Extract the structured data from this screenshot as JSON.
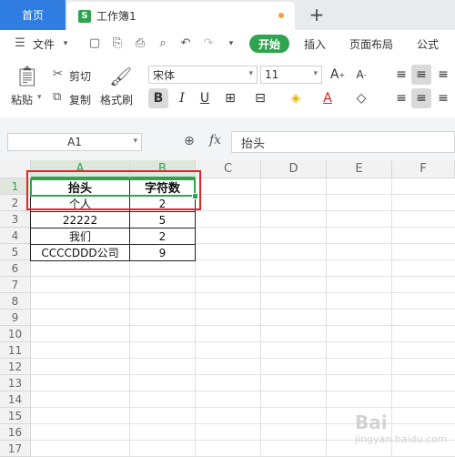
{
  "tabs": {
    "home": "首页",
    "workbook": "工作簿1",
    "add": "+"
  },
  "menu": {
    "file": "文件",
    "start": "开始",
    "insert": "插入",
    "page_layout": "页面布局",
    "formula": "公式"
  },
  "ribbon": {
    "paste": "粘贴",
    "cut": "剪切",
    "copy": "复制",
    "format_painter": "格式刷",
    "font_name": "宋体",
    "font_size": "11"
  },
  "formula_bar": {
    "name_box": "A1",
    "fx": "fx",
    "content": "抬头"
  },
  "grid": {
    "columns": [
      "A",
      "B",
      "C",
      "D",
      "E",
      "F"
    ],
    "rows": [
      "1",
      "2",
      "3",
      "4",
      "5",
      "6",
      "7",
      "8",
      "9",
      "10",
      "11",
      "12",
      "13",
      "14",
      "15",
      "16",
      "17"
    ],
    "table": [
      [
        "抬头",
        "字符数"
      ],
      [
        "个人",
        "2"
      ],
      [
        "22222",
        "5"
      ],
      [
        "我们",
        "2"
      ],
      [
        "CCCCDDD公司",
        "9"
      ]
    ]
  },
  "colors": {
    "accent": "#2ea44f",
    "home_tab": "#2f7de1",
    "annotation": "#e2252b"
  },
  "watermark": {
    "brand": "Bai",
    "sub": "jingyan.baidu.com"
  }
}
